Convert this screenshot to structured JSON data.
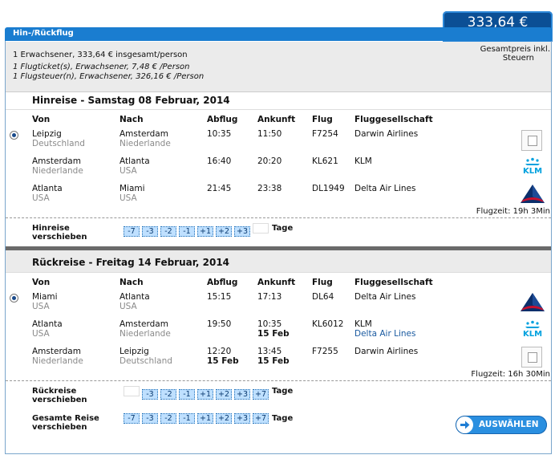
{
  "header": {
    "title": "Hin-/Rückflug",
    "price": "333,64 €"
  },
  "summary": {
    "line1": "1 Erwachsener, 333,64 € insgesamt/person",
    "line2": "1 Flugticket(s), Erwachsener, 7,48 € /Person",
    "line3": "1 Flugsteuer(n), Erwachsener, 326,16 € /Person",
    "total_label_1": "Gesamtpreis inkl.",
    "total_label_2": "Steuern"
  },
  "columns": {
    "from": "Von",
    "to": "Nach",
    "dep": "Abflug",
    "arr": "Ankunft",
    "flight": "Flug",
    "airline": "Fluggesellschaft"
  },
  "outbound": {
    "title": "Hinreise - Samstag 08 Februar, 2014",
    "legs": [
      {
        "from_city": "Leipzig",
        "from_country": "Deutschland",
        "to_city": "Amsterdam",
        "to_country": "Niederlande",
        "dep": "10:35",
        "arr": "11:50",
        "flight": "F7254",
        "airline": "Darwin Airlines"
      },
      {
        "from_city": "Amsterdam",
        "from_country": "Niederlande",
        "to_city": "Atlanta",
        "to_country": "USA",
        "dep": "16:40",
        "arr": "20:20",
        "flight": "KL621",
        "airline": "KLM"
      },
      {
        "from_city": "Atlanta",
        "from_country": "USA",
        "to_city": "Miami",
        "to_country": "USA",
        "dep": "21:45",
        "arr": "23:38",
        "flight": "DL1949",
        "airline": "Delta Air Lines"
      }
    ],
    "duration": "Flugzeit: 19h 3Min",
    "shift_label_1": "Hinreise",
    "shift_label_2": "verschieben",
    "shift_buttons": [
      "-7",
      "-3",
      "-2",
      "-1",
      "+1",
      "+2",
      "+3"
    ],
    "days_label": "Tage"
  },
  "return": {
    "title": "Rückreise - Freitag 14 Februar, 2014",
    "legs": [
      {
        "from_city": "Miami",
        "from_country": "USA",
        "to_city": "Atlanta",
        "to_country": "USA",
        "dep": "15:15",
        "arr": "17:13",
        "arr_date": "",
        "flight": "DL64",
        "airline": "Delta Air Lines",
        "airline2": ""
      },
      {
        "from_city": "Atlanta",
        "from_country": "USA",
        "to_city": "Amsterdam",
        "to_country": "Niederlande",
        "dep": "19:50",
        "arr": "10:35",
        "arr_date": "15 Feb",
        "flight": "KL6012",
        "airline": "KLM",
        "airline2": "Delta Air Lines"
      },
      {
        "from_city": "Amsterdam",
        "from_country": "Niederlande",
        "to_city": "Leipzig",
        "to_country": "Deutschland",
        "dep": "12:20",
        "dep_date": "15 Feb",
        "arr": "13:45",
        "arr_date": "15 Feb",
        "flight": "F7255",
        "airline": "Darwin Airlines",
        "airline2": ""
      }
    ],
    "duration": "Flugzeit: 16h 30Min",
    "shift_label_1": "Rückreise",
    "shift_label_2": "verschieben",
    "shift_buttons": [
      "-3",
      "-2",
      "-1",
      "+1",
      "+2",
      "+3",
      "+7"
    ],
    "days_label": "Tage"
  },
  "total_shift": {
    "label_1": "Gesamte Reise",
    "label_2": "verschieben",
    "shift_buttons": [
      "-7",
      "-3",
      "-2",
      "-1",
      "+1",
      "+2",
      "+3",
      "+7"
    ],
    "days_label": "Tage"
  },
  "select_button": "AUSWÄHLEN",
  "colors": {
    "accent": "#1a7dd0",
    "price_bg": "#0b4f95",
    "shift_bg": "#bfe0ff",
    "klm": "#00a1de",
    "delta": "#0b2f6b"
  },
  "icons": {
    "klm": "klm-logo",
    "delta": "delta-logo",
    "darwin": "broken-image-icon",
    "select": "arrow-right-icon"
  }
}
